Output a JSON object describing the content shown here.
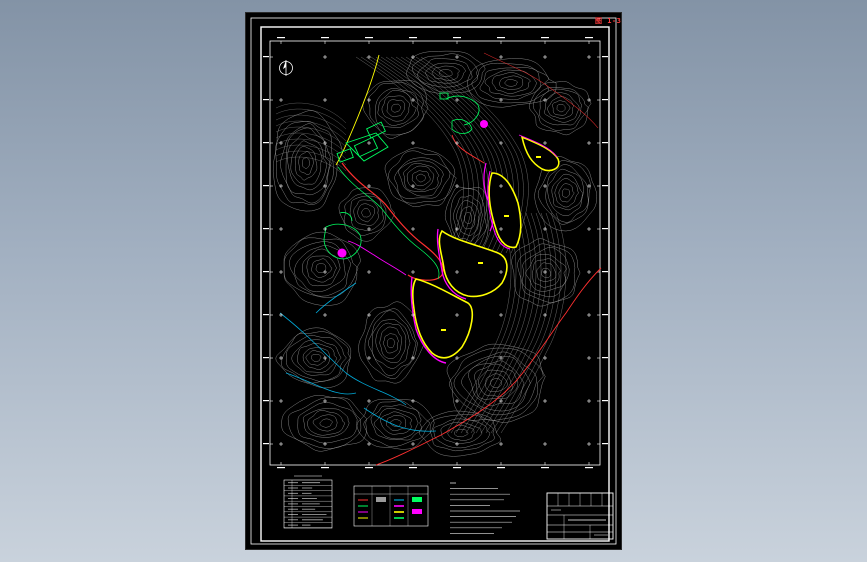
{
  "sheet": {
    "label": "图 1-3"
  },
  "colors": {
    "background": "#8a9aae",
    "paper": "#000000",
    "frame": "#ffffff",
    "contour": "#9a9a9a",
    "pit_outline": "#ff00ff",
    "pit_rim": "#ffff00",
    "haul_road": "#ff3030",
    "facility": "#00ff60",
    "stream": "#00c8ff",
    "boundary_road": "#ff3030",
    "access_road": "#ffff00"
  },
  "map": {
    "north_arrow_icon": "north-arrow-icon",
    "grid_marker_icon": "cross-marker-icon"
  },
  "legend": {
    "left_table_rows": 9,
    "symbol_rows": 6
  },
  "notes": {
    "line_count": 10
  },
  "title_block": {
    "rows": 5
  }
}
